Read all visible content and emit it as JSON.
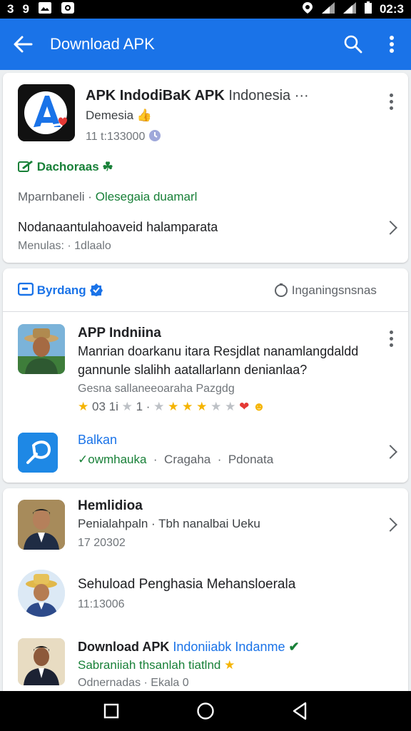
{
  "status_bar": {
    "left_icons": [
      "3",
      "9"
    ],
    "time": "02:3"
  },
  "app_bar": {
    "title": "Download APK",
    "back_icon": "arrow-left-icon",
    "search_icon": "search-icon",
    "more_icon": "more-vert-icon",
    "color": "#1a73e8"
  },
  "header_card": {
    "title_bold": "APK IndodiBaK APK",
    "title_light": "Indonesia",
    "title_ellipsis": "···",
    "subtitle": "Demesia",
    "count": "11 t:133000",
    "badge_label": "Dachoraas",
    "info_label": "Mparnbaneli ·",
    "info_value": "Olesegaia duamarl",
    "description": "Nodanaantulahoaveid halamparata",
    "meta_label": "Menulas: ·",
    "meta_value": "1dlaalo"
  },
  "section": {
    "left_label": "Byrdang",
    "right_label": "Inganingsnsnas"
  },
  "post_item": {
    "title": "APP Indniina",
    "body_line1": "Manrian doarkanu itara Resjdlat nanamlangdaldd",
    "body_line2": "gannunle slalihh aatallarlann denianlaa?",
    "meta": "Gesna sallaneeoaraha Pazgdg",
    "rating_text": "03 1i",
    "rating_sep": "1 ·",
    "stars_first": 1,
    "stars_second": 3,
    "stars_total": 5
  },
  "app_item": {
    "title": "Balkan",
    "status": "owmhauka",
    "meta_a": "Cragaha",
    "meta_b": "Pdonata"
  },
  "list_items": [
    {
      "title": "Hemlidioa",
      "subtitle": "Penialahpaln · Tbh nanalbai Ueku",
      "meta": "17 20302"
    },
    {
      "title": "Sehuload Penghasia Mehansloerala",
      "subtitle": "",
      "meta": "11:13006"
    },
    {
      "title": "Download APK",
      "title_accent": "Indoniiabk Indanme",
      "subtitle": "Sabraniiah thsanlah tiatlnd",
      "meta": "Odnernadas · Ekala 0"
    }
  ],
  "colors": {
    "accent": "#1a73e8",
    "green": "#188038",
    "star": "#f5b400"
  }
}
